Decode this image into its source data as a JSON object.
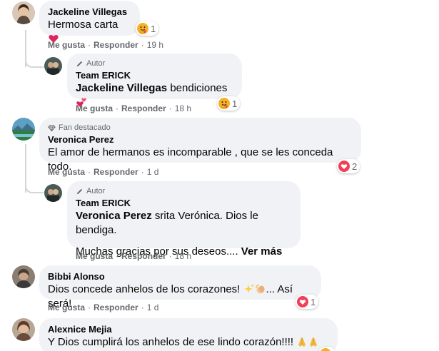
{
  "comments": [
    {
      "name": "Jackeline Villegas",
      "text": "Hermosa carta",
      "reaction_count": "1",
      "like": "Me gusta",
      "reply": "Responder",
      "time": "19 h"
    },
    {
      "badge": "Autor",
      "name": "Team ERICK",
      "mention": "Jackeline Villegas",
      "text": " bendiciones",
      "reaction_count": "1",
      "like": "Me gusta",
      "reply": "Responder",
      "time": "18 h"
    },
    {
      "badge": "Fan destacado",
      "name": "Veronica Perez",
      "text": "El amor de hermanos es incomparable , que se les conceda todo.",
      "reaction_count": "2",
      "like": "Me gusta",
      "reply": "Responder",
      "time": "1 d"
    },
    {
      "badge": "Autor",
      "name": "Team ERICK",
      "mention": "Veronica Perez",
      "text": " srita Verónica. Dios le bendiga.",
      "text2": "Muchas gracias por sus deseos.... ",
      "see_more": "Ver más",
      "like": "Me gusta",
      "reply": "Responder",
      "time": "18 h"
    },
    {
      "name": "Bibbi Alonso",
      "text": "Dios concede anhelos de los corazones! ",
      "text_end": "... Así será!",
      "reaction_count": "1",
      "like": "Me gusta",
      "reply": "Responder",
      "time": "1 d"
    },
    {
      "name": "Alexnice Mejia",
      "text": "Y Dios cumplirá los anhelos de ese lindo corazón!!!! "
    }
  ],
  "separator": "·",
  "icons": {
    "author_badge": "pencil-icon",
    "fan_badge": "diamond-icon",
    "care_reaction": "care-reaction-icon",
    "love_reaction": "love-reaction-icon",
    "hearts_emoji": "two-hearts-emoji",
    "sparkles_emoji": "sparkles-emoji",
    "clap_emoji": "clapping-hands-emoji",
    "pray_emoji": "praying-hands-emoji"
  },
  "colors": {
    "bubble_bg": "#f0f2f5",
    "meta_text": "#65676b",
    "love": "#f33e58",
    "care": "#f7b125"
  }
}
